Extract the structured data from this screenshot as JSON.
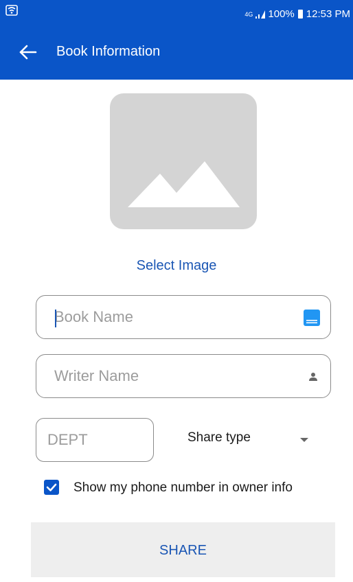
{
  "status_bar": {
    "network": "4G",
    "battery": "100%",
    "time": "12:53 PM",
    "icons": [
      "wifi-icon",
      "signal-icon",
      "battery-icon"
    ]
  },
  "app_bar": {
    "title": "Book Information",
    "back_icon": "arrow-back-icon"
  },
  "form": {
    "image_placeholder_icon": "image-placeholder-icon",
    "select_image_label": "Select Image",
    "book_name": {
      "value": "",
      "placeholder": "Book Name",
      "icon": "book-icon"
    },
    "writer_name": {
      "value": "",
      "placeholder": "Writer Name",
      "icon": "person-icon"
    },
    "dept": {
      "value": "",
      "placeholder": "DEPT"
    },
    "share_type": {
      "selected": "Share type",
      "icon": "dropdown-arrow-icon"
    },
    "show_phone": {
      "label": "Show my phone number in owner info",
      "checked": true
    },
    "share_button_label": "SHARE"
  },
  "colors": {
    "primary": "#0a55c8",
    "accent_text": "#1a56b4",
    "placeholder_bg": "#d4d4d4",
    "button_bg": "#eeeeee",
    "book_icon": "#2196f3"
  }
}
